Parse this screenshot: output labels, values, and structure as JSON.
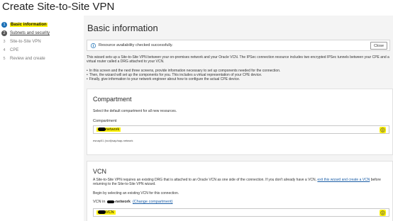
{
  "page_title": "Create Site-to-Site VPN",
  "sidebar": {
    "steps": [
      {
        "num": "1",
        "label": "Basic information",
        "state": "active"
      },
      {
        "num": "2",
        "label": "Subnets and security",
        "state": "done"
      },
      {
        "num": "3",
        "label": "Site-to-Site VPN",
        "state": "todo"
      },
      {
        "num": "4",
        "label": "CPE",
        "state": "todo"
      },
      {
        "num": "5",
        "label": "Review and create",
        "state": "todo"
      }
    ]
  },
  "main": {
    "heading": "Basic information",
    "alert": {
      "text": "Resource availability checked successfully.",
      "close_label": "Close"
    },
    "intro": "This wizard sets up a Site-to-Site VPN between your on-premises network and your Oracle VCN. The IPSec connection resource includes two encrypted IPSec tunnels between your CPE and a virtual router called a DRG attached to your VCN.",
    "bullets": [
      "In this screen and the next three screens, provide information necessary to set up components needed for the connection.",
      "Then, the wizard will set up the components for you. This includes a virtual representation of your CPE device.",
      "Finally, give information to your network engineer about how to configure the actual CPE device."
    ]
  },
  "compartment": {
    "title": "Compartment",
    "description": "Select the default compartment for all new resources.",
    "field_label": "Compartment",
    "selected_value": "network",
    "path_hint": "esnap01 (root)/sap/sap-network"
  },
  "vcn": {
    "title": "VCN",
    "description_part1": "A Site-to-Site VPN requires an existing DRG that is attached to an Oracle VCN as one side of the connection. If you don't already have a VCN, ",
    "description_link": "exit this wizard and create a VCN",
    "description_part2": " before returning to the Site-to-Site VPN wizard.",
    "begin_text": "Begin by selecting an existing VCN for this connection.",
    "vcn_in_label": "VCN in",
    "vcn_in_compartment": "-network",
    "change_link": "(Change compartment)",
    "selected_value": "VCN"
  },
  "colors": {
    "highlight": "#fff200",
    "accent": "#1a6fb5",
    "link": "#1a5da6",
    "main_bg": "#f4f4f4"
  }
}
